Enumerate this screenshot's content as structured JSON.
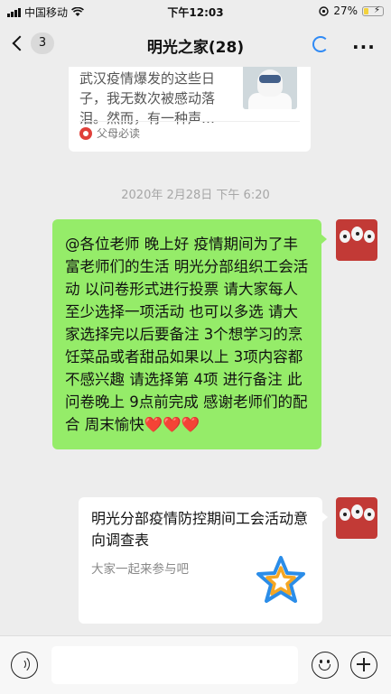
{
  "status_bar": {
    "carrier": "中国移动",
    "time": "下午12:03",
    "battery": "27%",
    "battery_level": 0.27
  },
  "nav": {
    "back_count": "3",
    "title": "明光之家(28)"
  },
  "article_card": {
    "summary": "武汉疫情爆发的这些日子，我无数次被感动落泪。然而，有一种声…",
    "source": "父母必读"
  },
  "timestamp": "2020年 2月28日 下午 6:20",
  "message": {
    "text": "@各位老师 晚上好 疫情期间为了丰富老师们的生活 明光分部组织工会活动 以问卷形式进行投票 请大家每人至少选择一项活动 也可以多选 请大家选择完以后要备注 3个想学习的烹饪菜品或者甜品如果以上 3项内容都不感兴趣 请选择第 4项 进行备注 此问卷晚上 9点前完成 感谢老师们的配合 周末愉快❤️❤️❤️"
  },
  "link_card": {
    "title": "明光分部疫情防控期间工会活动意向调查表",
    "description": "大家一起来参与吧"
  },
  "input_bar": {
    "placeholder": ""
  },
  "colors": {
    "bubble_green": "#95ec69",
    "background": "#ededed",
    "accent_blue": "#2f8af5",
    "avatar_red": "#c23a36"
  }
}
